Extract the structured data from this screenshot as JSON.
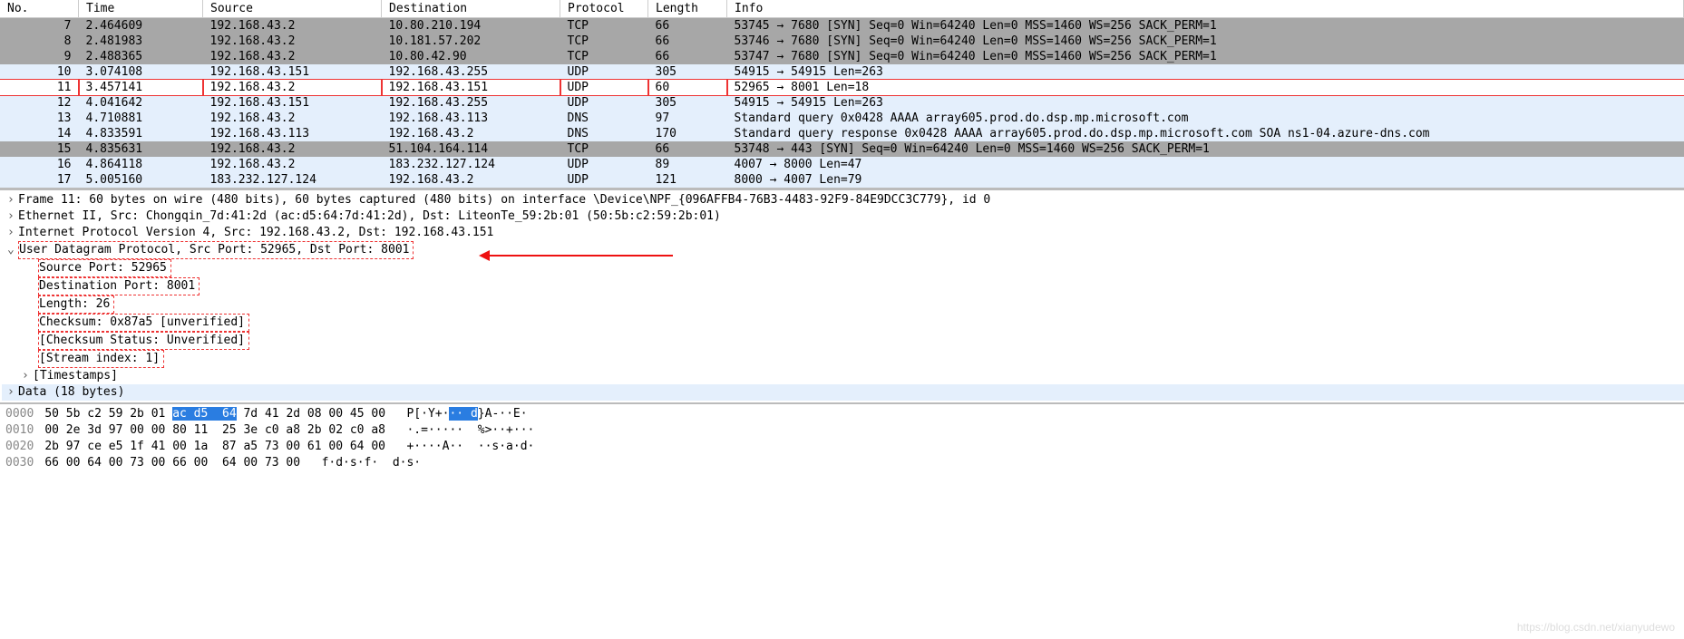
{
  "columns": [
    "No.",
    "Time",
    "Source",
    "Destination",
    "Protocol",
    "Length",
    "Info"
  ],
  "rows": [
    {
      "no": "7",
      "time": "2.464609",
      "src": "192.168.43.2",
      "dst": "10.80.210.194",
      "proto": "TCP",
      "len": "66",
      "info": "53745 → 7680 [SYN] Seq=0 Win=64240 Len=0 MSS=1460 WS=256 SACK_PERM=1",
      "cls": "row-darkgray"
    },
    {
      "no": "8",
      "time": "2.481983",
      "src": "192.168.43.2",
      "dst": "10.181.57.202",
      "proto": "TCP",
      "len": "66",
      "info": "53746 → 7680 [SYN] Seq=0 Win=64240 Len=0 MSS=1460 WS=256 SACK_PERM=1",
      "cls": "row-darkgray"
    },
    {
      "no": "9",
      "time": "2.488365",
      "src": "192.168.43.2",
      "dst": "10.80.42.90",
      "proto": "TCP",
      "len": "66",
      "info": "53747 → 7680 [SYN] Seq=0 Win=64240 Len=0 MSS=1460 WS=256 SACK_PERM=1",
      "cls": "row-darkgray"
    },
    {
      "no": "10",
      "time": "3.074108",
      "src": "192.168.43.151",
      "dst": "192.168.43.255",
      "proto": "UDP",
      "len": "305",
      "info": "54915 → 54915 Len=263",
      "cls": "row-lightblue"
    },
    {
      "no": "11",
      "time": "3.457141",
      "src": "192.168.43.2",
      "dst": "192.168.43.151",
      "proto": "UDP",
      "len": "60",
      "info": "52965 → 8001 Len=18",
      "cls": "row-selected"
    },
    {
      "no": "12",
      "time": "4.041642",
      "src": "192.168.43.151",
      "dst": "192.168.43.255",
      "proto": "UDP",
      "len": "305",
      "info": "54915 → 54915 Len=263",
      "cls": "row-lightblue"
    },
    {
      "no": "13",
      "time": "4.710881",
      "src": "192.168.43.2",
      "dst": "192.168.43.113",
      "proto": "DNS",
      "len": "97",
      "info": "Standard query 0x0428 AAAA array605.prod.do.dsp.mp.microsoft.com",
      "cls": "row-lightblue"
    },
    {
      "no": "14",
      "time": "4.833591",
      "src": "192.168.43.113",
      "dst": "192.168.43.2",
      "proto": "DNS",
      "len": "170",
      "info": "Standard query response 0x0428 AAAA array605.prod.do.dsp.mp.microsoft.com SOA ns1-04.azure-dns.com",
      "cls": "row-lightblue"
    },
    {
      "no": "15",
      "time": "4.835631",
      "src": "192.168.43.2",
      "dst": "51.104.164.114",
      "proto": "TCP",
      "len": "66",
      "info": "53748 → 443 [SYN] Seq=0 Win=64240 Len=0 MSS=1460 WS=256 SACK_PERM=1",
      "cls": "row-darkgray"
    },
    {
      "no": "16",
      "time": "4.864118",
      "src": "192.168.43.2",
      "dst": "183.232.127.124",
      "proto": "UDP",
      "len": "89",
      "info": "4007 → 8000 Len=47",
      "cls": "row-lightblue"
    },
    {
      "no": "17",
      "time": "5.005160",
      "src": "183.232.127.124",
      "dst": "192.168.43.2",
      "proto": "UDP",
      "len": "121",
      "info": "8000 → 4007 Len=79",
      "cls": "row-lightblue"
    }
  ],
  "details": {
    "frame": "Frame 11: 60 bytes on wire (480 bits), 60 bytes captured (480 bits) on interface \\Device\\NPF_{096AFFB4-76B3-4483-92F9-84E9DCC3C779}, id 0",
    "eth": "Ethernet II, Src: Chongqin_7d:41:2d (ac:d5:64:7d:41:2d), Dst: LiteonTe_59:2b:01 (50:5b:c2:59:2b:01)",
    "ip": "Internet Protocol Version 4, Src: 192.168.43.2, Dst: 192.168.43.151",
    "udp": "User Datagram Protocol, Src Port: 52965, Dst Port: 8001",
    "udp_src": "Source Port: 52965",
    "udp_dst": "Destination Port: 8001",
    "udp_len": "Length: 26",
    "udp_chk": "Checksum: 0x87a5 [unverified]",
    "udp_chk_status": "[Checksum Status: Unverified]",
    "udp_stream": "[Stream index: 1]",
    "timestamps": "[Timestamps]",
    "data": "Data (18 bytes)"
  },
  "hex": [
    {
      "off": "0000",
      "b1": "50 5b c2 59 2b 01 ",
      "sel": "ac d5  64",
      "b2": " 7d 41 2d 08 00 45 00",
      "a1": "P[·Y+·",
      "asel": "·· d",
      "a2": "}A-··E·"
    },
    {
      "off": "0010",
      "b1": "00 2e 3d 97 00 00 80 11  25 3e c0 a8 2b 02 c0 a8",
      "sel": "",
      "b2": "",
      "a1": "·.=·····  %>··+···",
      "asel": "",
      "a2": ""
    },
    {
      "off": "0020",
      "b1": "2b 97 ce e5 1f 41 00 1a  87 a5 73 00 61 00 64 00",
      "sel": "",
      "b2": "",
      "a1": "+····A··  ··s·a·d·",
      "asel": "",
      "a2": ""
    },
    {
      "off": "0030",
      "b1": "66 00 64 00 73 00 66 00  64 00 73 00",
      "sel": "",
      "b2": "",
      "a1": "f·d·s·f·  d·s·",
      "asel": "",
      "a2": ""
    }
  ],
  "watermark": "https://blog.csdn.net/xianyudewo"
}
